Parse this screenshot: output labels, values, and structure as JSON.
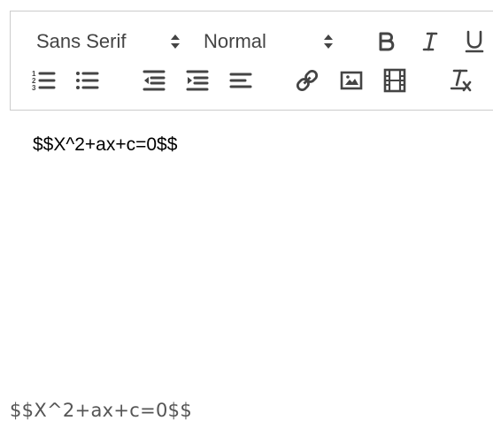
{
  "toolbar": {
    "font_picker": {
      "selected": "Sans Serif",
      "icon": "updown-arrows-icon"
    },
    "size_picker": {
      "selected": "Normal",
      "icon": "updown-arrows-icon"
    },
    "buttons": [
      {
        "name": "bold",
        "icon": "bold-icon"
      },
      {
        "name": "italic",
        "icon": "italic-icon"
      },
      {
        "name": "underline",
        "icon": "underline-icon"
      },
      {
        "name": "ordered-list",
        "icon": "ordered-list-icon"
      },
      {
        "name": "bullet-list",
        "icon": "bullet-list-icon"
      },
      {
        "name": "outdent",
        "icon": "outdent-icon"
      },
      {
        "name": "indent",
        "icon": "indent-icon"
      },
      {
        "name": "align",
        "icon": "align-left-icon"
      },
      {
        "name": "link",
        "icon": "link-icon"
      },
      {
        "name": "image",
        "icon": "image-icon"
      },
      {
        "name": "video",
        "icon": "video-icon"
      },
      {
        "name": "clean",
        "icon": "clear-format-icon"
      }
    ],
    "border_color": "#cccccc",
    "icon_color": "#444444"
  },
  "editor": {
    "content": "$$X^2+ax+c=0$$"
  },
  "preview": {
    "text": "$$X^2+ax+c=0$$",
    "color": "#555555"
  }
}
